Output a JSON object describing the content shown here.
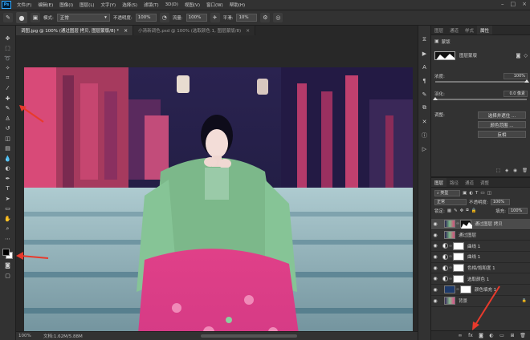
{
  "menu": {
    "logo": "Ps",
    "items": [
      "文件(F)",
      "编辑(E)",
      "图像(I)",
      "图层(L)",
      "文字(Y)",
      "选择(S)",
      "滤镜(T)",
      "3D(D)",
      "视图(V)",
      "窗口(W)",
      "帮助(H)"
    ]
  },
  "options": {
    "mode_label": "模式:",
    "mode_value": "正常",
    "opacity_label": "不透明度:",
    "opacity_value": "100%",
    "flow_label": "流量:",
    "flow_value": "100%",
    "smooth_label": "平滑:",
    "smooth_value": "10%"
  },
  "tabs": [
    {
      "label": "调图.jpg @ 100% (通过图层 拷贝, 图层蒙版/8) *"
    },
    {
      "label": "小清新调色.psd @ 100% (选取颜色 1, 图层蒙版/8)"
    }
  ],
  "status": {
    "zoom": "100%",
    "doc": "文档:1.62M/5.88M"
  },
  "properties": {
    "tabs": [
      "图层",
      "通道",
      "样式",
      "属性"
    ],
    "header": "蒙版",
    "mask_label": "图层蒙版",
    "density_label": "浓度:",
    "density_value": "100%",
    "density_fraction": 1.0,
    "feather_label": "羽化:",
    "feather_value": "0.0 像素",
    "feather_fraction": 0.0,
    "adjust_label": "调整:",
    "buttons": [
      "选择并遮住 ...",
      "颜色范围 ...",
      "反相"
    ]
  },
  "layers_panel": {
    "tabs": [
      "图层",
      "路径",
      "通道",
      "调整"
    ],
    "kind_label": "类型",
    "blend_mode": "正常",
    "opacity_label": "不透明度:",
    "opacity_value": "100%",
    "lock_label": "锁定:",
    "fill_label": "填充:",
    "fill_value": "100%",
    "layers": [
      {
        "name": "通过图层 拷贝",
        "kind": "mask-layer",
        "selected": true
      },
      {
        "name": "通过图层",
        "kind": "pixel",
        "selected": false
      },
      {
        "name": "曲线 1",
        "kind": "adjustment",
        "selected": false
      },
      {
        "name": "曲线 1",
        "kind": "adjustment",
        "selected": false
      },
      {
        "name": "色相/饱和度 1",
        "kind": "adjustment",
        "selected": false
      },
      {
        "name": "选取颜色 1",
        "kind": "adjustment",
        "selected": false
      },
      {
        "name": "颜色填充 1",
        "kind": "fill",
        "selected": false
      },
      {
        "name": "背景",
        "kind": "background",
        "selected": false
      }
    ]
  },
  "colors": {
    "annotation_arrow": "#e83a2c",
    "accent": "#31a8ff"
  }
}
